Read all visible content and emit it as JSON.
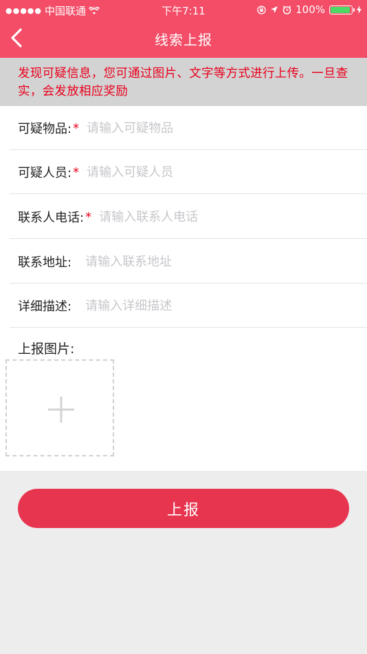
{
  "status_bar": {
    "signal_dots": "●●●●●",
    "carrier": "中国联通",
    "time": "下午7:11",
    "battery_percent": "100%"
  },
  "nav": {
    "title": "线索上报"
  },
  "notice": {
    "text": "发现可疑信息，您可通过图片、文字等方式进行上传。一旦查实，会发放相应奖励"
  },
  "form": {
    "fields": [
      {
        "label": "可疑物品:",
        "required": true,
        "placeholder": "请输入可疑物品",
        "value": ""
      },
      {
        "label": "可疑人员:",
        "required": true,
        "placeholder": "请输入可疑人员",
        "value": ""
      },
      {
        "label": "联系人电话:",
        "required": true,
        "placeholder": "请输入联系人电话",
        "value": ""
      },
      {
        "label": "联系地址:",
        "required": false,
        "placeholder": "请输入联系地址",
        "value": ""
      },
      {
        "label": "详细描述:",
        "required": false,
        "placeholder": "请输入详细描述",
        "value": ""
      }
    ],
    "required_mark": "*",
    "upload_label": "上报图片:"
  },
  "submit_label": "上报",
  "colors": {
    "header": "#F34D67",
    "button": "#E8354F",
    "notice_text": "#E8001C",
    "notice_bg": "#D3D3D3"
  },
  "icons": [
    "signal-dots-icon",
    "wifi-icon",
    "orientation-lock-icon",
    "location-arrow-icon",
    "alarm-icon",
    "battery-icon",
    "charging-icon",
    "back-chevron-icon",
    "add-image-plus-icon"
  ]
}
